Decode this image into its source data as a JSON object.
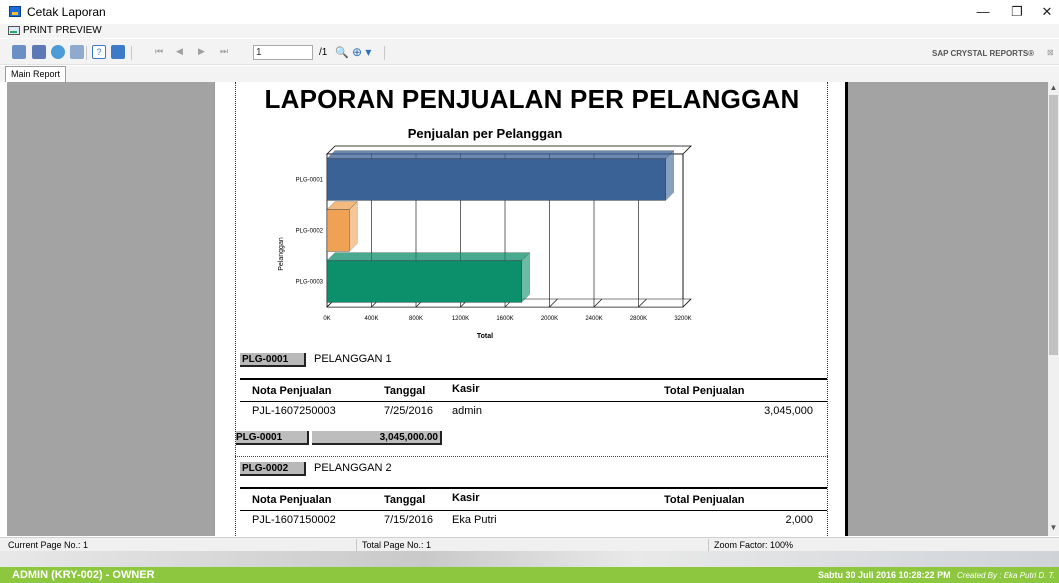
{
  "window": {
    "title": "Cetak Laporan",
    "minimize": "—",
    "restore": "❐",
    "close": "✕"
  },
  "menu": {
    "print_preview": "PRINT PREVIEW"
  },
  "toolbar": {
    "page_value": "1",
    "page_total": "/1",
    "brand": "SAP CRYSTAL REPORTS®",
    "first": "⏮",
    "prev": "◀",
    "next": "▶",
    "last": "⏭",
    "help": "?",
    "find": "🔍",
    "zoom": "⊕ ▾"
  },
  "tabs": {
    "main": "Main Report"
  },
  "report": {
    "title": "LAPORAN PENJUALAN PER PELANGGAN",
    "columns": {
      "nota": "Nota Penjualan",
      "tanggal": "Tanggal",
      "kasir": "Kasir",
      "total": "Total Penjualan"
    },
    "groups": [
      {
        "code": "PLG-0001",
        "name": "PELANGGAN 1",
        "rows": [
          {
            "nota": "PJL-1607250003",
            "tanggal": "7/25/2016",
            "kasir": "admin",
            "total": "3,045,000"
          }
        ],
        "summary_code": "PLG-0001",
        "summary_total": "3,045,000.00"
      },
      {
        "code": "PLG-0002",
        "name": "PELANGGAN 2",
        "rows": [
          {
            "nota": "PJL-1607150002",
            "tanggal": "7/15/2016",
            "kasir": "Eka Putri",
            "total": "2,000"
          }
        ]
      }
    ]
  },
  "chart_data": {
    "type": "bar",
    "orientation": "horizontal",
    "title": "Penjualan per Pelanggan",
    "xlabel": "Total",
    "ylabel": "Pelanggan",
    "categories": [
      "PLG-0001",
      "PLG-0002",
      "PLG-0003"
    ],
    "values": [
      3045000,
      200000,
      1750000
    ],
    "xlim": [
      0,
      3200000
    ],
    "xticks": [
      "0K",
      "400K",
      "800K",
      "1200K",
      "1600K",
      "2000K",
      "2400K",
      "2800K",
      "3200K"
    ],
    "colors": [
      "#3a6297",
      "#f0a254",
      "#0c8f6b"
    ],
    "grid": true
  },
  "status": {
    "current_page": "Current Page No.: 1",
    "total_page": "Total Page No.: 1",
    "zoom": "Zoom Factor: 100%"
  },
  "appbar": {
    "user": "ADMIN (KRY-002) - OWNER",
    "datetime": "Sabtu  30 Juli 2016  10:28:22 PM",
    "credit": "Created By : Eka Putri D. T."
  }
}
